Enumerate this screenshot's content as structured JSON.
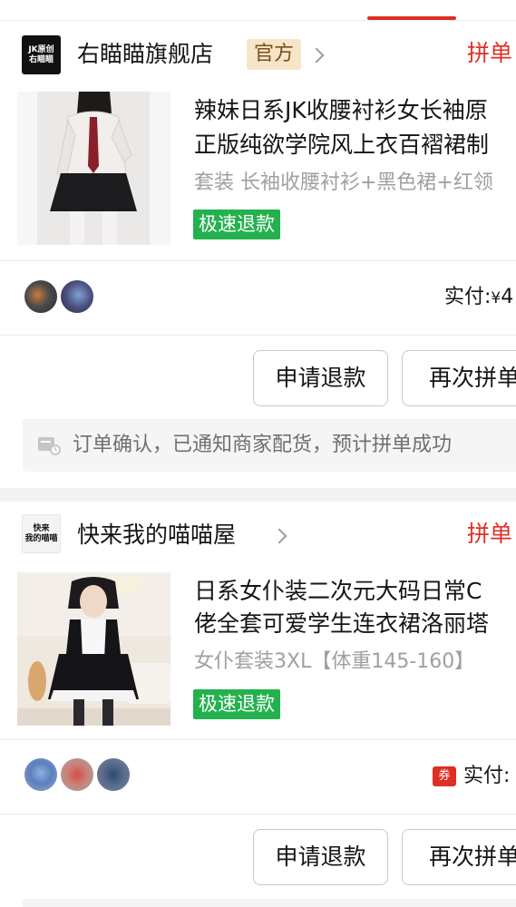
{
  "orders": [
    {
      "shop": {
        "logo_lines": [
          "JK原创",
          "右瞄瞄"
        ],
        "name": "右瞄瞄旗舰店",
        "badge": "官方"
      },
      "status": "拼单",
      "product": {
        "image": "schoolgirl-uniform-photo",
        "title_line1": "辣妹日系JK收腰衬衫女长袖原",
        "title_line2": "正版纯欲学院风上衣百褶裙制",
        "spec": "套装 长袖收腰衬衫+黑色裙+红领",
        "tag": "极速退款"
      },
      "payment": {
        "label": "实付:",
        "currency": "¥",
        "amount": "4"
      },
      "actions": {
        "refund": "申请退款",
        "reorder": "再次拼单"
      },
      "notice": {
        "icon": "truck-icon",
        "text": "订单确认，已通知商家配货，预计拼单成功"
      }
    },
    {
      "shop": {
        "logo_lines": [
          "快来",
          "我的喵喵"
        ],
        "name": "快来我的喵喵屋"
      },
      "status": "拼单",
      "product": {
        "image": "maid-outfit-photo",
        "title_line1": "日系女仆装二次元大码日常C",
        "title_line2": "佬全套可爱学生连衣裙洛丽塔",
        "spec": "女仆套装3XL【体重145-160】",
        "tag": "极速退款"
      },
      "payment": {
        "coupon_icon_label": "券",
        "label": "实付:"
      },
      "actions": {
        "refund": "申请退款",
        "reorder": "再次拼单"
      }
    }
  ],
  "colors": {
    "accent": "#e02e24",
    "refund_tag": "#23b14d",
    "badge_bg": "#f7e5c8",
    "text": "#151516",
    "muted": "#a0a0a0"
  }
}
